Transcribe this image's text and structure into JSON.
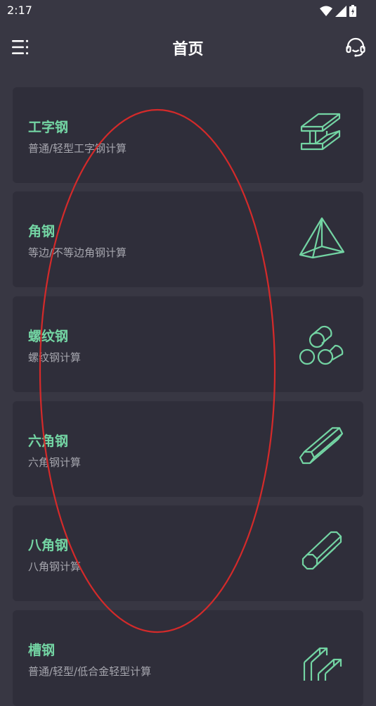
{
  "status_bar": {
    "time": "2:17"
  },
  "header": {
    "title": "首页"
  },
  "categories": [
    {
      "title": "工字钢",
      "subtitle": "普通/轻型工字钢计算",
      "icon": "i-beam-icon"
    },
    {
      "title": "角钢",
      "subtitle": "等边/不等边角钢计算",
      "icon": "angle-steel-icon"
    },
    {
      "title": "螺纹钢",
      "subtitle": "螺纹钢计算",
      "icon": "rebar-icon"
    },
    {
      "title": "六角钢",
      "subtitle": "六角钢计算",
      "icon": "hexagon-steel-icon"
    },
    {
      "title": "八角钢",
      "subtitle": "八角钢计算",
      "icon": "octagon-steel-icon"
    },
    {
      "title": "槽钢",
      "subtitle": "普通/轻型/低合金轻型计算",
      "icon": "channel-steel-icon"
    }
  ],
  "colors": {
    "background": "#383743",
    "card": "#2f2e3a",
    "accent": "#73d4a3",
    "annotation": "#d42a2a"
  }
}
